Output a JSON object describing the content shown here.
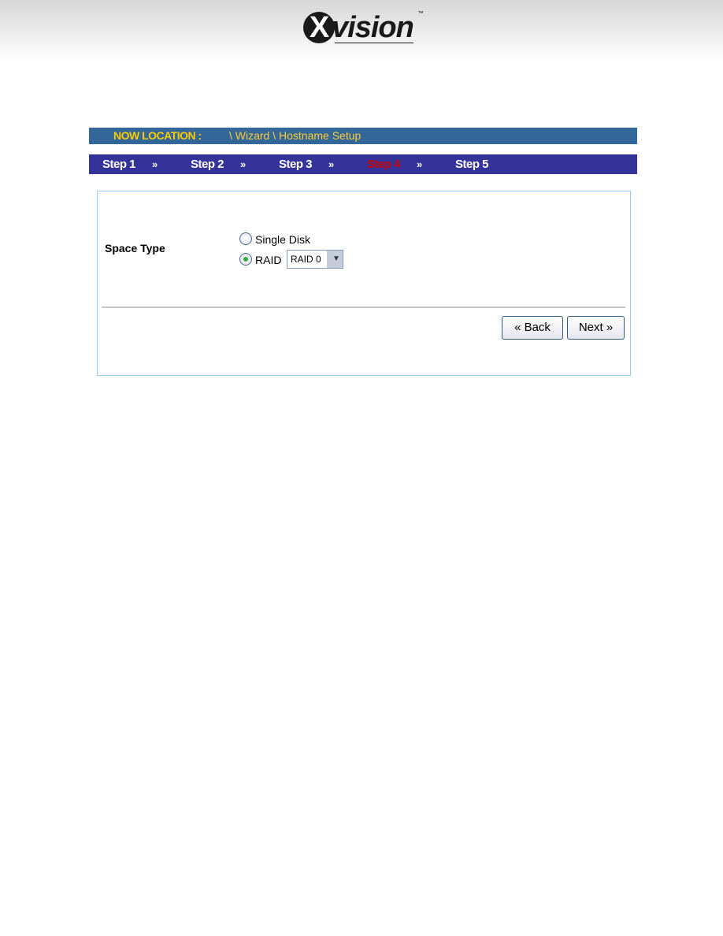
{
  "brand": {
    "logo_text": "Xvision",
    "trademark": "™"
  },
  "location": {
    "label": "NOW LOCATION :",
    "path": "\\ Wizard \\ Hostname Setup"
  },
  "steps": [
    {
      "label": "Step 1"
    },
    {
      "label": "Step 2"
    },
    {
      "label": "Step 3"
    },
    {
      "label": "Step 4",
      "active": true
    },
    {
      "label": "Step 5"
    }
  ],
  "step_separator": "»",
  "form": {
    "space_type_label": "Space Type",
    "options": [
      {
        "label": "Single Disk",
        "selected": false
      },
      {
        "label": "RAID",
        "selected": true
      }
    ],
    "raid_level": "RAID 0"
  },
  "buttons": {
    "back": "« Back",
    "next": "Next »"
  },
  "colors": {
    "location_bar": "#336699",
    "steps_bar": "#333399",
    "active_step": "#cc0000",
    "location_text": "#ffcc00"
  }
}
